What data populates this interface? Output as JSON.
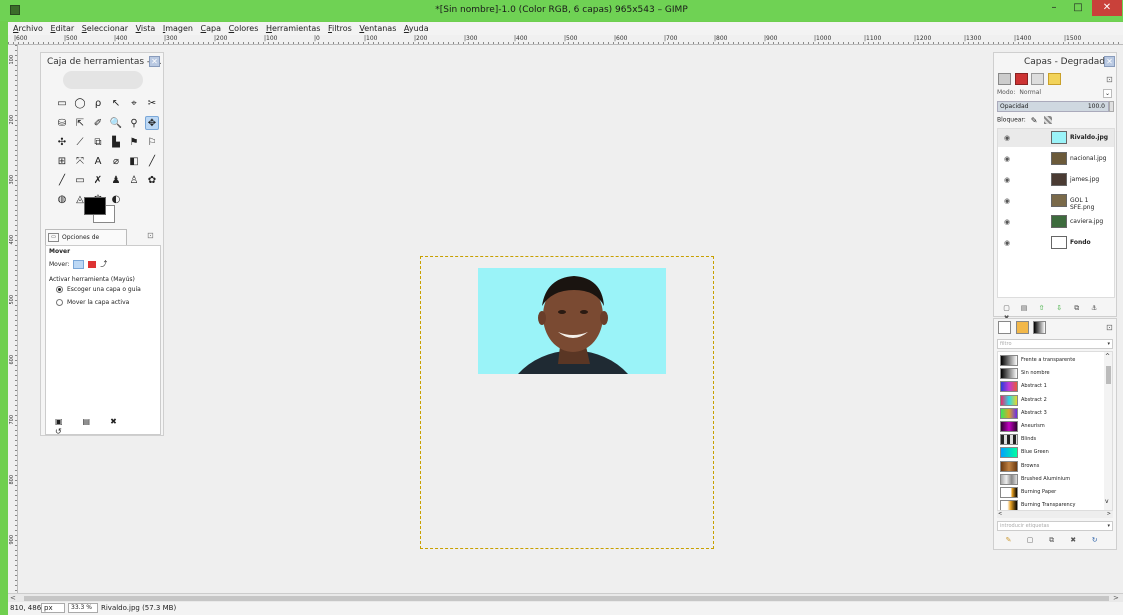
{
  "window": {
    "title": "*[Sin nombre]-1.0 (Color RGB, 6 capas) 965x543 – GIMP",
    "min_label": "–",
    "max_label": "□",
    "close_label": "✕"
  },
  "menu": [
    "Archivo",
    "Editar",
    "Seleccionar",
    "Vista",
    "Imagen",
    "Capa",
    "Colores",
    "Herramientas",
    "Filtros",
    "Ventanas",
    "Ayuda"
  ],
  "ruler": {
    "h_labels": [
      "|600",
      "|500",
      "|400",
      "|300",
      "|200",
      "|100",
      "|0",
      "|100",
      "|200",
      "|300",
      "|400",
      "|500",
      "|600",
      "|700",
      "|800",
      "|900",
      "|1000",
      "|1100",
      "|1200",
      "|1300",
      "|1400",
      "|1500"
    ],
    "v_labels": [
      "100",
      "200",
      "300",
      "400",
      "500",
      "600",
      "700",
      "800",
      "900"
    ]
  },
  "toolbox": {
    "title": "Caja de herramientas - ...",
    "close": "✕",
    "tools": [
      "▭",
      "◯",
      "ρ",
      "↖",
      "⌖",
      "✂",
      "⛁",
      "⇱",
      "✐",
      "🔍",
      "⚲",
      "✥",
      "✣",
      "⟋",
      "⧉",
      "▙",
      "⚑",
      "⚐",
      "⊞",
      "⤧",
      "A",
      "⌀",
      "◧",
      "╱",
      "╱",
      "▭",
      "✗",
      "♟",
      "♙",
      "✿",
      "◍",
      "◬",
      "✾",
      "◐"
    ],
    "active_tool_index": 11,
    "options_tab": "Opciones de herramienta",
    "options_config": "⊡",
    "tool_name": "Mover",
    "mode_label": "Mover:",
    "activate_label": "Activar herramienta  (Mayús)",
    "radio1": "Escoger una capa o guía",
    "radio2": "Mover la capa activa",
    "foot": [
      "▣",
      "▤",
      "✖",
      "↺"
    ]
  },
  "layers_panel": {
    "title": "Capas - Degradados",
    "close": "✕",
    "modo_label": "Modo:",
    "modo_value": "Normal",
    "opacidad_label": "Opacidad",
    "opacidad_value": "100.0",
    "bloquear_label": "Bloquear:",
    "config": "⊡",
    "dropdown": "⌄",
    "layers": [
      {
        "name": "Rivaldo.jpg",
        "bold": true,
        "selected": true,
        "thumb": "#9af3f8"
      },
      {
        "name": "nacional.jpg",
        "bold": false,
        "selected": false,
        "thumb": "#6b5a3a"
      },
      {
        "name": "james.jpg",
        "bold": false,
        "selected": false,
        "thumb": "#4a3b33"
      },
      {
        "name": "GOL 1 SFE.png",
        "bold": false,
        "selected": false,
        "thumb": "#7a6a4a"
      },
      {
        "name": "caviera.jpg",
        "bold": false,
        "selected": false,
        "thumb": "#3d6b3d"
      },
      {
        "name": "Fondo",
        "bold": true,
        "selected": false,
        "thumb": "#ffffff"
      }
    ],
    "eye": "◉",
    "foot": [
      "▢",
      "▤",
      "⇧",
      "⇩",
      "⧉",
      "⚓",
      "✖"
    ]
  },
  "gradients_panel": {
    "filter_placeholder": "filtro",
    "dd": "▾",
    "config": "⊡",
    "items": [
      {
        "name": "Frente a transparente",
        "css": "linear-gradient(90deg,#000,rgba(0,0,0,0))"
      },
      {
        "name": "Sin nombre",
        "css": "linear-gradient(90deg,#000,#fff)"
      },
      {
        "name": "Abstract 1",
        "css": "linear-gradient(90deg,#2a3bd8,#c03ad8,#e85a3a)"
      },
      {
        "name": "Abstract 2",
        "css": "linear-gradient(90deg,#e82a6a,#2ad8e8,#e8d82a)"
      },
      {
        "name": "Abstract 3",
        "css": "linear-gradient(90deg,#3ae85a,#d8a82a,#6a2ae8)"
      },
      {
        "name": "Aneurism",
        "css": "linear-gradient(90deg,#300030,#c000c0,#300030)"
      },
      {
        "name": "Blinds",
        "css": "repeating-linear-gradient(90deg,#222 0 3px,#ddd 3px 6px)"
      },
      {
        "name": "Blue Green",
        "css": "linear-gradient(90deg,#00a0ff,#00ffa0)"
      },
      {
        "name": "Browns",
        "css": "linear-gradient(90deg,#6a3a10,#c08040,#6a3a10)"
      },
      {
        "name": "Brushed Aluminium",
        "css": "linear-gradient(90deg,#aaa,#eee,#888,#ddd)"
      },
      {
        "name": "Burning Paper",
        "css": "linear-gradient(90deg,#fff 60%,#e8a020 70%,#000)"
      },
      {
        "name": "Burning Transparency",
        "css": "linear-gradient(90deg,rgba(0,0,0,0) 40%,#e8a020 60%,#000)"
      }
    ],
    "scroll_up": "^",
    "scroll_down": "v",
    "hscroll_left": "<",
    "hscroll_right": ">",
    "tag_placeholder": "introducir etiquetas",
    "foot": [
      "✎",
      "▢",
      "⧉",
      "✖",
      "↻"
    ]
  },
  "status": {
    "coords": "810, 486",
    "unit": "px",
    "zoom": "33.3 %",
    "message": "Rivaldo.jpg (57.3 MB)"
  },
  "scroll": {
    "left": "<",
    "right": ">"
  }
}
